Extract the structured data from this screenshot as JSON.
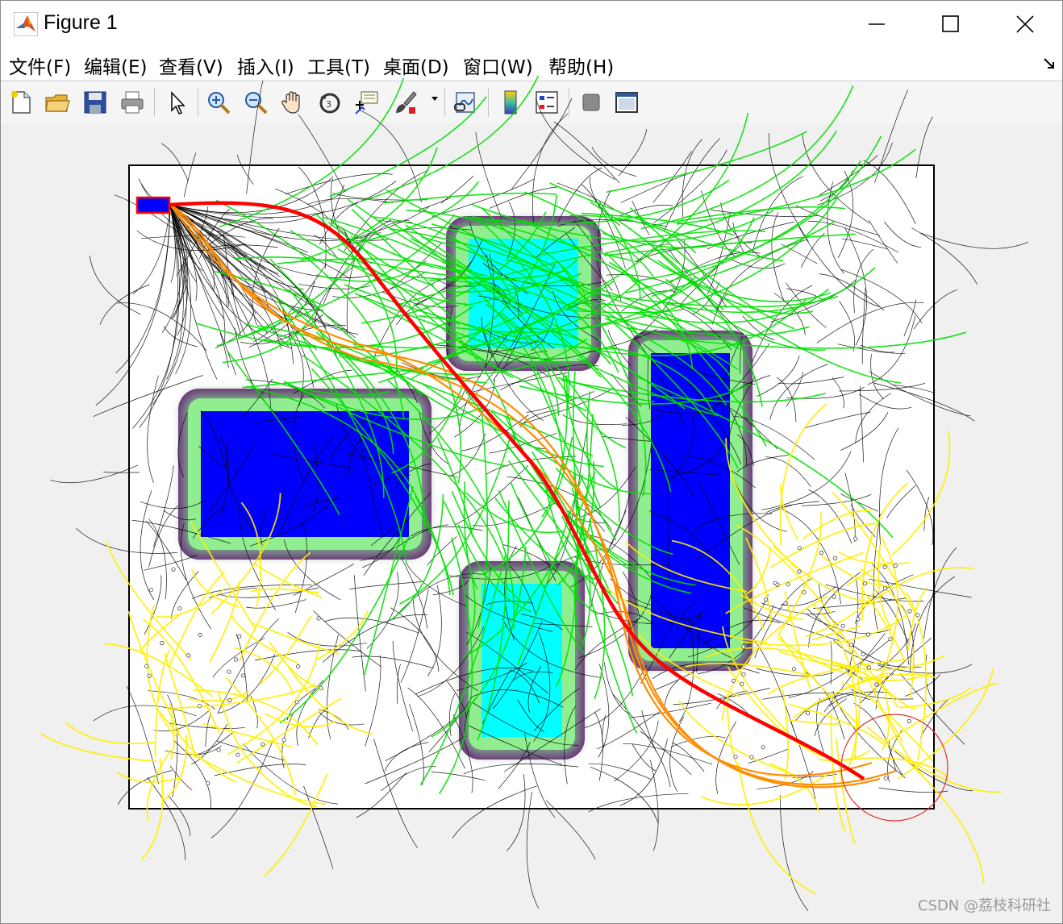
{
  "window": {
    "title": "Figure 1"
  },
  "menu": {
    "items": [
      "文件(F)",
      "编辑(E)",
      "查看(V)",
      "插入(I)",
      "工具(T)",
      "桌面(D)",
      "窗口(W)",
      "帮助(H)"
    ]
  },
  "toolbar": {
    "buttons": [
      "new-figure-icon",
      "open-file-icon",
      "save-icon",
      "print-icon",
      "edit-pointer-icon",
      "zoom-in-icon",
      "zoom-out-icon",
      "pan-hand-icon",
      "rotate-3d-icon",
      "data-cursor-icon",
      "brush-icon",
      "link-plot-icon",
      "colorbar-icon",
      "legend-icon",
      "hide-plot-tools-icon",
      "show-plot-tools-icon"
    ]
  },
  "plot": {
    "colors": {
      "obstacle_core": "#0000ff",
      "obstacle_core_light": "#00ffff",
      "obstacle_halo_inner": "#90ee90",
      "obstacle_halo_outer": "#6b2a78",
      "path": "#ff0000",
      "tree_branches": "#000000",
      "green_branches": "#00e000",
      "yellow_branches": "#ffee00",
      "orange_branches": "#ff8c00",
      "goal_circle": "#e03030",
      "start_vehicle": "#0000ff"
    }
  },
  "watermark": "CSDN @荔枝科研社"
}
